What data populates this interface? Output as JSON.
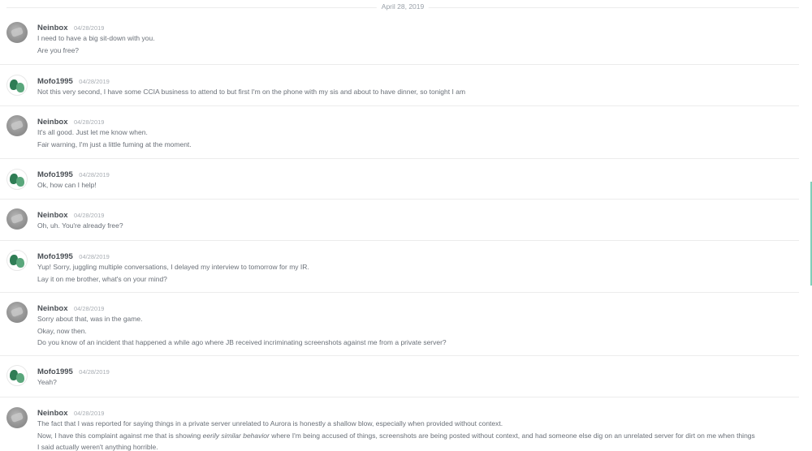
{
  "date_divider": "April 28, 2019",
  "messages": [
    {
      "username": "Neinbox",
      "timestamp": "04/28/2019",
      "lines": [
        "I need to have a big sit-down with you.",
        "Are you free?"
      ]
    },
    {
      "username": "Mofo1995",
      "timestamp": "04/28/2019",
      "lines": [
        "Not this very second, I have some CCIA business to attend to but first I'm on the phone with my sis and about to have dinner, so tonight I am"
      ]
    },
    {
      "username": "Neinbox",
      "timestamp": "04/28/2019",
      "lines": [
        "It's all good. Just let me know when.",
        "Fair warning, I'm just a little fuming at the moment."
      ]
    },
    {
      "username": "Mofo1995",
      "timestamp": "04/28/2019",
      "lines": [
        "Ok, how can I help!"
      ]
    },
    {
      "username": "Neinbox",
      "timestamp": "04/28/2019",
      "lines": [
        "Oh, uh. You're already free?"
      ]
    },
    {
      "username": "Mofo1995",
      "timestamp": "04/28/2019",
      "lines": [
        "Yup! Sorry, juggling multiple conversations, I delayed my interview to tomorrow for my IR.",
        "Lay it on me brother, what's on your mind?"
      ]
    },
    {
      "username": "Neinbox",
      "timestamp": "04/28/2019",
      "lines": [
        "Sorry about that, was in the game.",
        "Okay, now then.",
        "Do you know of an incident that happened a while ago where JB received incriminating screenshots against me from a private server?"
      ]
    },
    {
      "username": "Mofo1995",
      "timestamp": "04/28/2019",
      "lines": [
        "Yeah?"
      ]
    },
    {
      "username": "Neinbox",
      "timestamp": "04/28/2019",
      "line1": "The fact that I was reported for saying things in a private server unrelated to Aurora is honestly a shallow blow, especially when provided without context.",
      "line2_before": "Now, I have this complaint against me that is showing ",
      "line2_em": "eerily similar behavior",
      "line2_after": " where I'm being accused of things, screenshots are being posted without context, and had someone else dig on an unrelated server for dirt on me when things",
      "line3": "I said actually weren't anything horrible."
    }
  ]
}
